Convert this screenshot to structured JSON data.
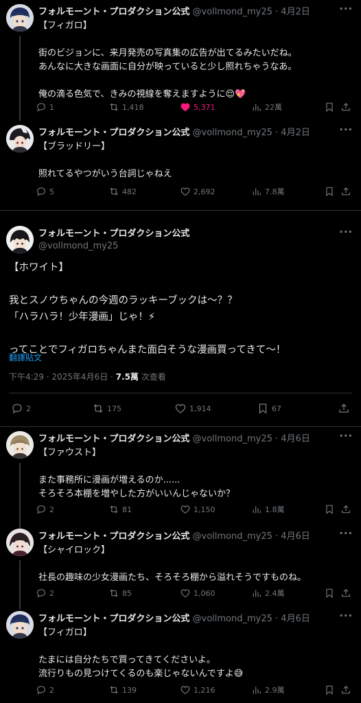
{
  "account": {
    "name": "フォルモーント・プロダクション公式",
    "handle": "@vollmond_my25"
  },
  "thread_top": [
    {
      "date": "4月2日",
      "body": "【フィガロ】\n\n街のビジョンに、来月発売の写真集の広告が出てるみたいだね。\nあんなに大きな画面に自分が映っていると少し照れちゃうなあ。\n\n俺の滴る色気で、きみの視線を奪えますように😌💖",
      "replies": "1",
      "reposts": "1,418",
      "likes": "5,371",
      "views": "22萬",
      "liked": true
    },
    {
      "date": "4月2日",
      "body": "【ブラッドリー】\n\n照れてるやつがいう台詞じゃねえ",
      "replies": "5",
      "reposts": "482",
      "likes": "2,692",
      "views": "7.8萬",
      "liked": false
    }
  ],
  "main_post": {
    "body": "【ホワイト】\n\n我とスノウちゃんの今週のラッキーブックは〜？？\n「ハラハラ！少年漫画」じゃ！⚡\n\nってことでフィガロちゃんまた面白そうな漫画買ってきて〜！",
    "translate": "翻譯貼文",
    "timestamp": "下午4:29 · 2025年4月6日 · ",
    "views_count": "7.5萬",
    "views_label": " 次查看",
    "replies": "2",
    "reposts": "175",
    "likes": "1,914",
    "bookmarks": "67"
  },
  "thread_bottom": [
    {
      "date": "4月6日",
      "body": "【ファウスト】\n\nまた事務所に漫画が増えるのか......\nそろそろ本棚を増やした方がいいんじゃないか？",
      "replies": "2",
      "reposts": "81",
      "likes": "1,150",
      "views": "1.8萬"
    },
    {
      "date": "4月6日",
      "body": "【シャイロック】\n\n社長の趣味の少女漫画たち、そろそろ棚から溢れそうですものね。",
      "replies": "2",
      "reposts": "85",
      "likes": "1,060",
      "views": "2.4萬"
    },
    {
      "date": "4月6日",
      "body": "【フィガロ】\n\nたまには自分たちで買ってきてくださいよ。\n流行りもの見つけてくるのも楽じゃないんですよ😅",
      "replies": "2",
      "reposts": "139",
      "likes": "1,216",
      "views": "2.9萬"
    }
  ],
  "icons": {
    "reply": "reply-icon",
    "repost": "repost-icon",
    "like": "heart-icon",
    "views": "views-icon",
    "bookmark": "bookmark-icon",
    "share": "share-icon",
    "more": "more-icon"
  },
  "colors": {
    "like_active": "#f91880",
    "link": "#1d9bf0",
    "muted": "#71767b",
    "background": "#000000"
  }
}
